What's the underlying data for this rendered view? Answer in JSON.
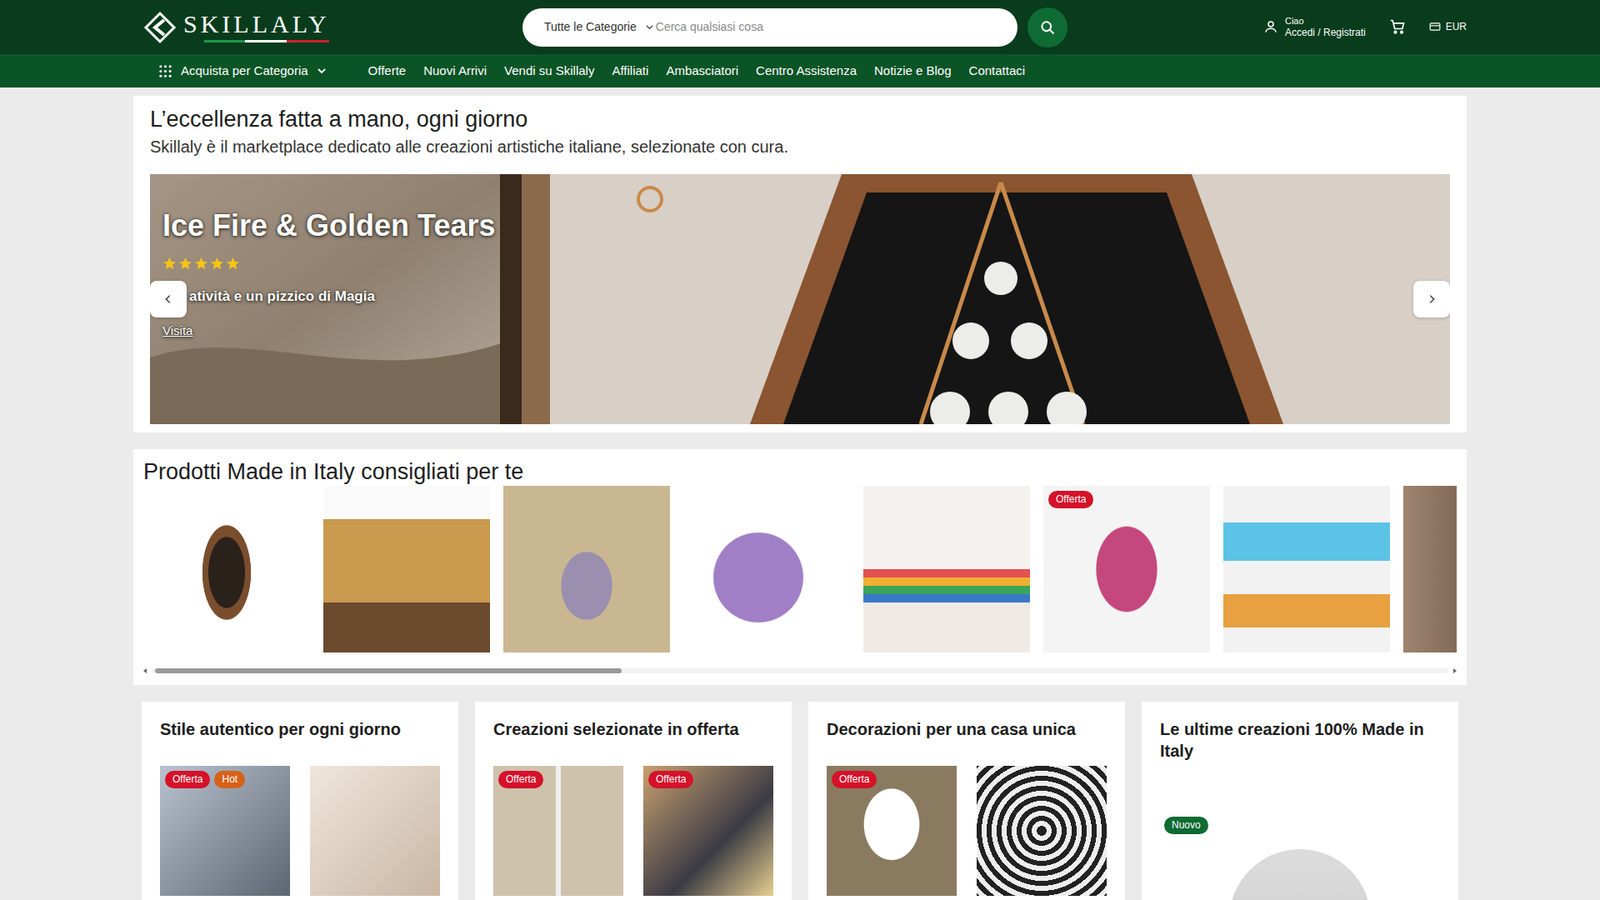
{
  "header": {
    "logo": "SKILLALY",
    "category": "Tutte le Categorie",
    "search_placeholder": "Cerca qualsiasi cosa",
    "greeting": "Ciao",
    "account": "Accedi / Registrati",
    "currency": "EUR"
  },
  "nav": {
    "categories": "Acquista per Categoria",
    "links": [
      "Offerte",
      "Nuovi Arrivi",
      "Vendi su Skillaly",
      "Affiliati",
      "Ambasciatori",
      "Centro Assistenza",
      "Notizie e Blog",
      "Contattaci"
    ]
  },
  "hero": {
    "title": "L’eccellenza fatta a mano, ogni giorno",
    "subtitle": "Skillaly è il marketplace dedicato alle creazioni artistiche italiane, selezionate con cura.",
    "slide": {
      "title": "Ice Fire & Golden Tears",
      "stars": 5,
      "tagline": "atività e un pizzico di Magia",
      "link": "Visita"
    }
  },
  "recommended": {
    "title": "Prodotti Made in Italy consigliati per te",
    "products": [
      {
        "badges": []
      },
      {
        "badges": []
      },
      {
        "badges": []
      },
      {
        "badges": []
      },
      {
        "badges": []
      },
      {
        "badges": [
          {
            "label": "Offerta",
            "color": "#d6112a"
          }
        ]
      },
      {
        "badges": []
      },
      {
        "badges": []
      }
    ],
    "scrollbar": {
      "level": 0.36
    }
  },
  "collections": [
    {
      "title": "Stile autentico per ogni giorno",
      "kind": "pair",
      "items": [
        {
          "badges": [
            {
              "label": "Offerta",
              "color": "#d6112a"
            },
            {
              "label": "Hot",
              "color": "#d8611a"
            }
          ]
        },
        {
          "badges": []
        }
      ]
    },
    {
      "title": "Creazioni selezionate in offerta",
      "kind": "pair",
      "items": [
        {
          "badges": [
            {
              "label": "Offerta",
              "color": "#d6112a"
            }
          ]
        },
        {
          "badges": [
            {
              "label": "Offerta",
              "color": "#d6112a"
            }
          ]
        }
      ]
    },
    {
      "title": "Decorazioni per una casa unica",
      "kind": "pair",
      "items": [
        {
          "badges": [
            {
              "label": "Offerta",
              "color": "#d6112a"
            }
          ]
        },
        {
          "badges": []
        }
      ]
    },
    {
      "title": "Le ultime creazioni 100% Made in Italy",
      "kind": "single",
      "items": [
        {
          "badges": [
            {
              "label": "Nuovo",
              "color": "#0e6b33"
            }
          ]
        }
      ]
    }
  ]
}
